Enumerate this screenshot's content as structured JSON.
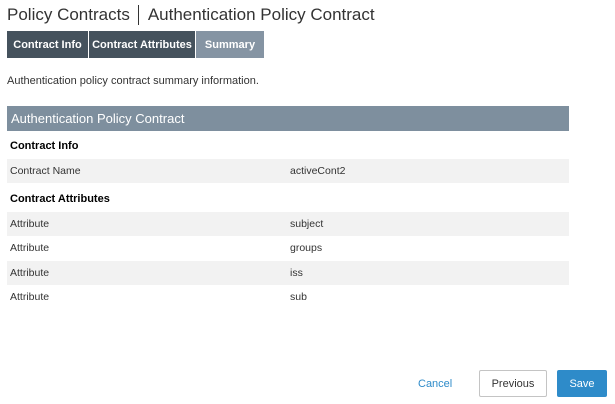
{
  "header": {
    "breadcrumb_parent": "Policy Contracts",
    "title": "Authentication Policy Contract"
  },
  "tabs": [
    {
      "label": "Contract Info",
      "state": "done"
    },
    {
      "label": "Contract Attributes",
      "state": "done"
    },
    {
      "label": "Summary",
      "state": "current"
    }
  ],
  "intro_text": "Authentication policy contract summary information.",
  "section": {
    "title": "Authentication Policy Contract",
    "contract_info": {
      "heading": "Contract Info",
      "rows": [
        {
          "label": "Contract Name",
          "value": "activeCont2"
        }
      ]
    },
    "contract_attributes": {
      "heading": "Contract Attributes",
      "rows": [
        {
          "label": "Attribute",
          "value": "subject"
        },
        {
          "label": "Attribute",
          "value": "groups"
        },
        {
          "label": "Attribute",
          "value": "iss"
        },
        {
          "label": "Attribute",
          "value": "sub"
        }
      ]
    }
  },
  "footer": {
    "cancel_label": "Cancel",
    "previous_label": "Previous",
    "save_label": "Save"
  },
  "colors": {
    "tab_done": "#45525d",
    "tab_current": "#8594a3",
    "section_bar": "#7e8f9e",
    "primary": "#2e8bc9"
  }
}
